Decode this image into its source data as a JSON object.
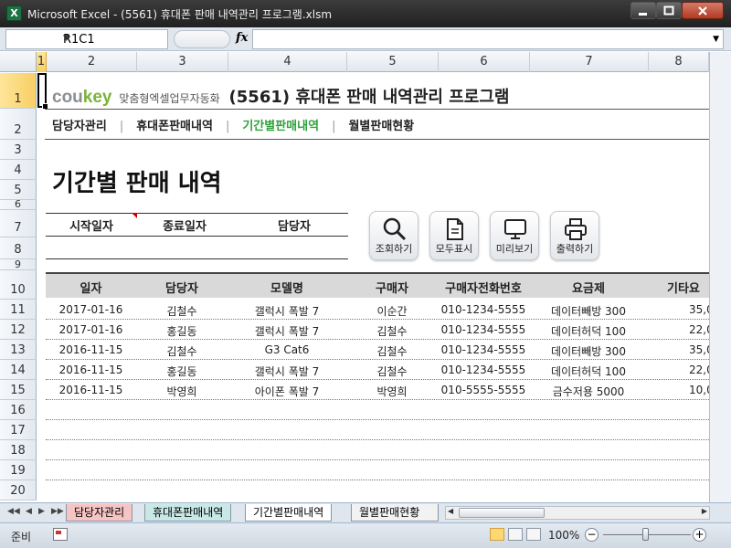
{
  "window": {
    "title": "Microsoft Excel - (5561) 휴대폰 판매 내역관리 프로그램.xlsm",
    "app_icon": "X"
  },
  "formula_bar": {
    "name_box": "R1C1",
    "fx": "fx",
    "formula": ""
  },
  "columns": [
    "1",
    "2",
    "3",
    "4",
    "5",
    "6",
    "7",
    "8"
  ],
  "rows": [
    "1",
    "2",
    "3",
    "4",
    "5",
    "6",
    "7",
    "8",
    "9",
    "10",
    "11",
    "12",
    "13",
    "14",
    "15",
    "16",
    "17",
    "18",
    "19",
    "20"
  ],
  "header": {
    "logo_prefix": "cou",
    "logo_suffix": "key",
    "tagline": "맞춤형엑셀업무자동화",
    "program_title": "(5561) 휴대폰 판매 내역관리 프로그램"
  },
  "nav": {
    "items": [
      "담당자관리",
      "휴대폰판매내역",
      "기간별판매내역",
      "월별판매현황"
    ],
    "separator": "|",
    "active_index": 2
  },
  "page_title": "기간별 판매 내역",
  "filters": {
    "start_date_label": "시작일자",
    "end_date_label": "종료일자",
    "staff_label": "담당자"
  },
  "tools": [
    {
      "icon": "search-icon",
      "label": "조회하기"
    },
    {
      "icon": "document-icon",
      "label": "모두표시"
    },
    {
      "icon": "monitor-icon",
      "label": "미리보기"
    },
    {
      "icon": "printer-icon",
      "label": "출력하기"
    }
  ],
  "table": {
    "headers": [
      "일자",
      "담당자",
      "모델명",
      "구매자",
      "구매자전화번호",
      "요금제",
      "기타요"
    ],
    "rows": [
      [
        "2017-01-16",
        "김철수",
        "갤럭시 폭발 7",
        "이순간",
        "010-1234-5555",
        "데이터빼방 300",
        "35,0"
      ],
      [
        "2017-01-16",
        "홍길동",
        "갤럭시 폭발 7",
        "김철수",
        "010-1234-5555",
        "데이터허덕 100",
        "22,0"
      ],
      [
        "2016-11-15",
        "김철수",
        "G3 Cat6",
        "김철수",
        "010-1234-5555",
        "데이터빼방 300",
        "35,0"
      ],
      [
        "2016-11-15",
        "홍길동",
        "갤럭시 폭발 7",
        "김철수",
        "010-1234-5555",
        "데이터허덕 100",
        "22,0"
      ],
      [
        "2016-11-15",
        "박영희",
        "아이폰 폭발 7",
        "박영희",
        "010-5555-5555",
        "금수저용 5000",
        "10,0"
      ]
    ]
  },
  "sheet_tabs": [
    "담당자관리",
    "휴대폰판매내역",
    "기간별판매내역",
    "월별판매현황"
  ],
  "status": {
    "ready": "준비",
    "zoom": "100%",
    "zoom_level_percent": 100
  },
  "colors": {
    "accent_green": "#2fa23a",
    "logo_green": "#7bb33b",
    "excel_green": "#1e7145"
  }
}
